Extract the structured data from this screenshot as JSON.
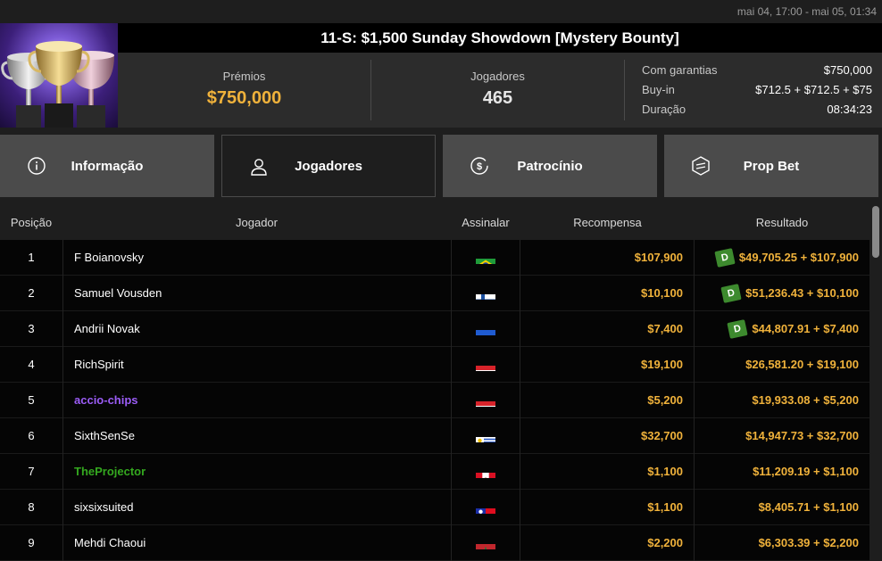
{
  "date_range": "mai 04, 17:00 - mai 05, 01:34",
  "tournament": {
    "title": "11-S: $1,500 Sunday Showdown [Mystery Bounty]",
    "prizes_label": "Prémios",
    "prizes_value": "$750,000",
    "players_label": "Jogadores",
    "players_value": "465",
    "details": [
      {
        "label": "Com garantias",
        "value": "$750,000"
      },
      {
        "label": "Buy-in",
        "value": "$712.5 + $712.5 + $75"
      },
      {
        "label": "Duração",
        "value": "08:34:23"
      }
    ]
  },
  "tabs": [
    {
      "label": "Informação",
      "icon": "info-icon"
    },
    {
      "label": "Jogadores",
      "icon": "user-icon"
    },
    {
      "label": "Patrocínio",
      "icon": "dollar-coin-icon"
    },
    {
      "label": "Prop Bet",
      "icon": "prop-bet-icon"
    }
  ],
  "table": {
    "headers": {
      "position": "Posição",
      "player": "Jogador",
      "flag": "Assinalar",
      "reward": "Recompensa",
      "result": "Resultado"
    },
    "rows": [
      {
        "pos": "1",
        "player": "F Boianovsky",
        "flag": "brazil",
        "reward": "$107,900",
        "result": "$49,705.25 + $107,900",
        "badge": "D",
        "style": "normal"
      },
      {
        "pos": "2",
        "player": "Samuel Vousden",
        "flag": "finland",
        "reward": "$10,100",
        "result": "$51,236.43 + $10,100",
        "badge": "D",
        "style": "normal"
      },
      {
        "pos": "3",
        "player": "Andrii Novak",
        "flag": "ukraine",
        "reward": "$7,400",
        "result": "$44,807.91 + $7,400",
        "badge": "D",
        "style": "normal"
      },
      {
        "pos": "4",
        "player": "RichSpirit",
        "flag": "austria",
        "reward": "$19,100",
        "result": "$26,581.20 + $19,100",
        "badge": "",
        "style": "normal"
      },
      {
        "pos": "5",
        "player": "accio-chips",
        "flag": "austria",
        "reward": "$5,200",
        "result": "$19,933.08 + $5,200",
        "badge": "",
        "style": "purple"
      },
      {
        "pos": "6",
        "player": "SixthSenSe",
        "flag": "uruguay",
        "reward": "$32,700",
        "result": "$14,947.73 + $32,700",
        "badge": "",
        "style": "normal"
      },
      {
        "pos": "7",
        "player": "TheProjector",
        "flag": "peru",
        "reward": "$1,100",
        "result": "$11,209.19 + $1,100",
        "badge": "",
        "style": "green"
      },
      {
        "pos": "8",
        "player": "sixsixsuited",
        "flag": "taiwan",
        "reward": "$1,100",
        "result": "$8,405.71 + $1,100",
        "badge": "",
        "style": "normal"
      },
      {
        "pos": "9",
        "player": "Mehdi Chaoui",
        "flag": "morocco",
        "reward": "$2,200",
        "result": "$6,303.39 + $2,200",
        "badge": "",
        "style": "normal"
      }
    ]
  },
  "colors": {
    "accent_gold": "#f0b23b",
    "purple_name": "#9b5cf6",
    "green_name": "#34a81f",
    "badge_green": "#3d8a2e"
  }
}
